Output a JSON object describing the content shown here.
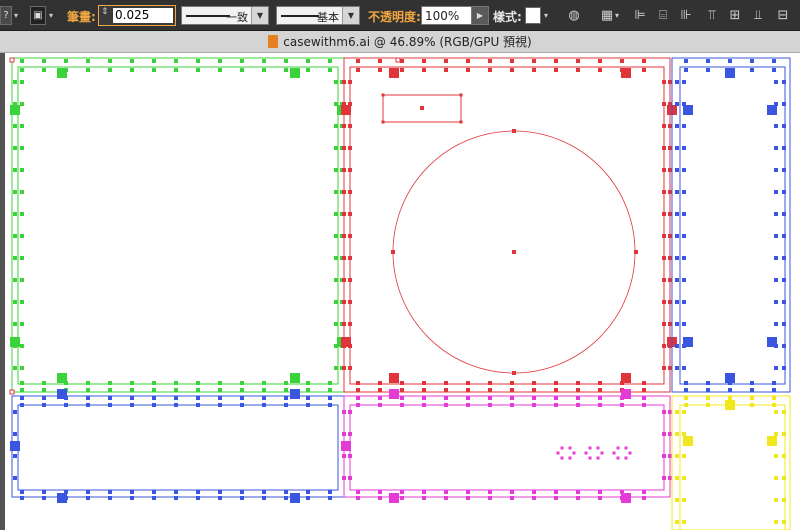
{
  "control_bar": {
    "stroke_label": "筆畫:",
    "stroke_value": "0.025",
    "profile_label": "一致",
    "brush_label": "基本",
    "opacity_label": "不透明度:",
    "opacity_value": "100%",
    "style_label": "樣式:"
  },
  "document_tab": {
    "title": "casewithm6.ai @ 46.89% (RGB/GPU 預視)"
  },
  "colors": {
    "green": "#3ad33a",
    "red": "#e0343a",
    "blue": "#3a55e0",
    "magenta": "#e43ad6",
    "yellow": "#f0e81c",
    "accent": "#f2a742"
  },
  "icons": [
    "question-mark-icon",
    "fill-stroke-icon",
    "stroke-arrows-icon",
    "color-wheel-icon",
    "align-grid-icon",
    "align-left-icon",
    "align-center-icon",
    "align-right-icon",
    "align-top-icon",
    "align-middle-icon",
    "align-bottom-icon"
  ]
}
